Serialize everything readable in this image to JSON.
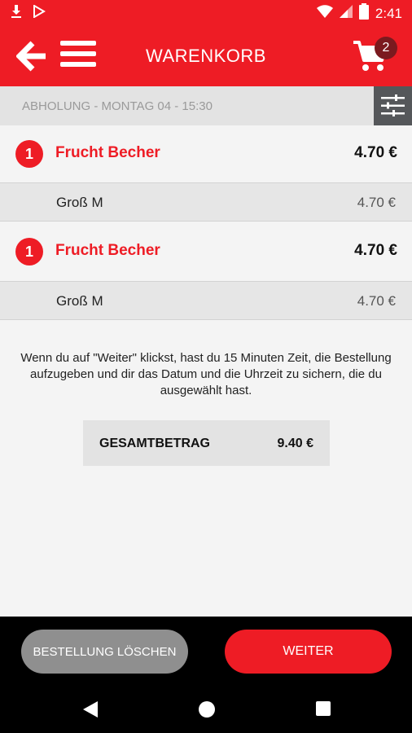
{
  "status": {
    "time": "2:41"
  },
  "header": {
    "title": "WARENKORB",
    "cart_count": "2"
  },
  "pickup": {
    "text": "ABHOLUNG - MONTAG 04 - 15:30"
  },
  "items": [
    {
      "qty": "1",
      "name": "Frucht Becher",
      "price": "4.70 €",
      "option": "Groß M",
      "option_price": "4.70 €"
    },
    {
      "qty": "1",
      "name": "Frucht Becher",
      "price": "4.70 €",
      "option": "Groß M",
      "option_price": "4.70 €"
    }
  ],
  "notice": "Wenn du auf \"Weiter\" klickst, hast du 15 Minuten Zeit, die Bestellung aufzugeben und dir das Datum und die Uhrzeit zu sichern, die du ausgewählt hast.",
  "total": {
    "label": "GESAMTBETRAG",
    "value": "9.40 €"
  },
  "actions": {
    "delete_label": "BESTELLUNG LÖSCHEN",
    "next_label": "WEITER"
  },
  "colors": {
    "accent": "#ee1c25",
    "badge": "#7b1a1f",
    "filter_bg": "#55575a"
  },
  "icons": [
    "download-icon",
    "play-store-icon",
    "wifi-icon",
    "signal-icon",
    "battery-icon",
    "back-arrow-icon",
    "menu-icon",
    "cart-icon",
    "filter-icon",
    "nav-back-icon",
    "nav-home-icon",
    "nav-recents-icon"
  ]
}
